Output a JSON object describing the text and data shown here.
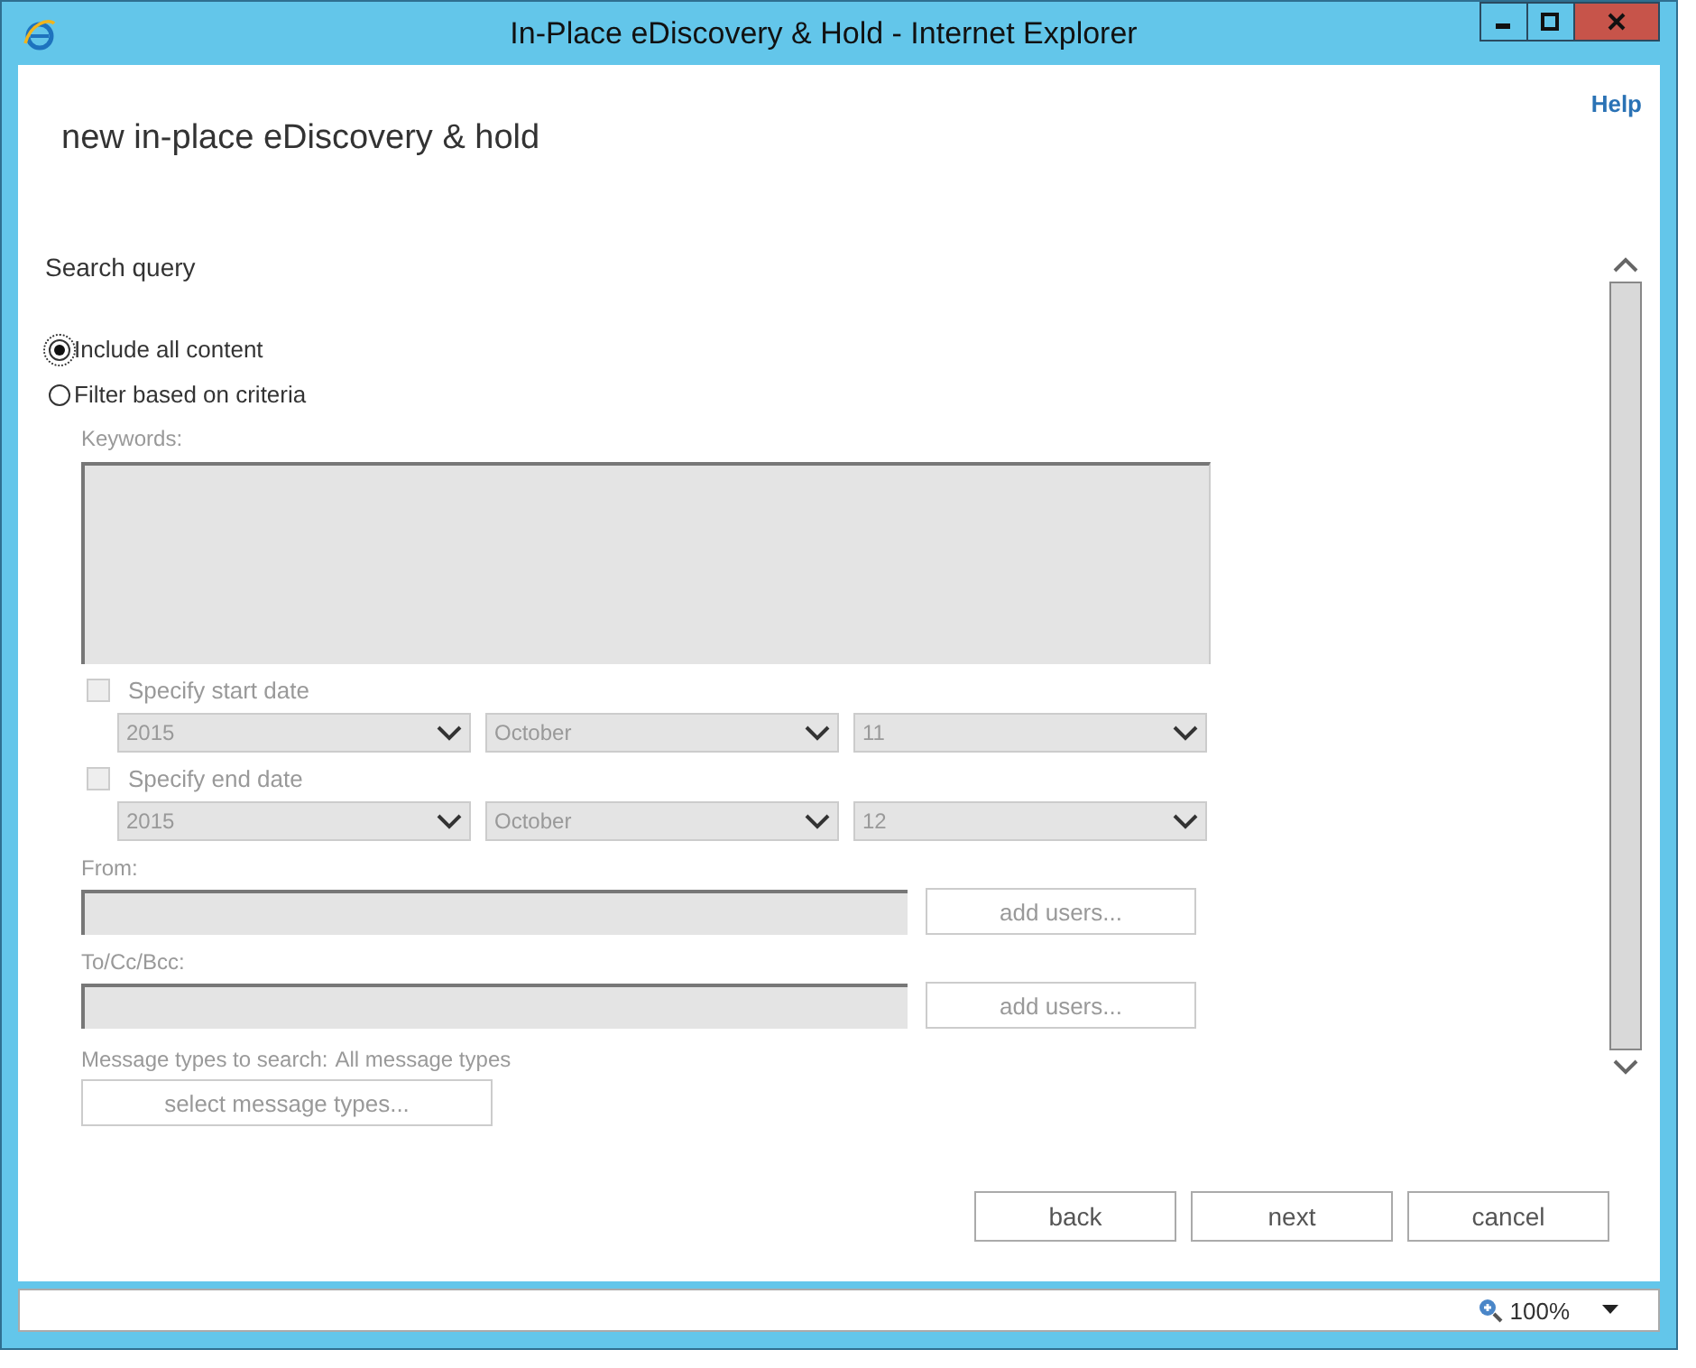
{
  "window": {
    "title": "In-Place eDiscovery & Hold - Internet Explorer"
  },
  "help_link": "Help",
  "page_title": "new in-place eDiscovery & hold",
  "section_title": "Search query",
  "radios": [
    {
      "label": "Include all content",
      "selected": true
    },
    {
      "label": "Filter based on criteria",
      "selected": false
    }
  ],
  "keywords": {
    "label": "Keywords:"
  },
  "date_filters": [
    {
      "label": "Specify start date",
      "checked": false,
      "selects": [
        "2015",
        "October",
        "11"
      ]
    },
    {
      "label": "Specify end date",
      "checked": false,
      "selects": [
        "2015",
        "October",
        "12"
      ]
    }
  ],
  "recipients": [
    {
      "label": "From:",
      "button": "add users..."
    },
    {
      "label": "To/Cc/Bcc:",
      "button": "add users..."
    }
  ],
  "message_types": {
    "label": "Message types to search:",
    "value": "All message types",
    "button": "select message types..."
  },
  "buttons": [
    "back",
    "next",
    "cancel"
  ],
  "status_bar": {
    "zoom": "100%"
  }
}
